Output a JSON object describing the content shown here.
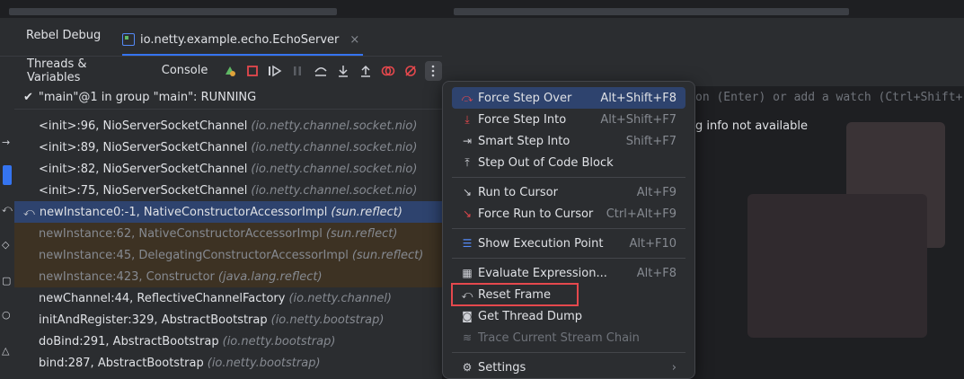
{
  "header": {
    "tool_title": "Rebel Debug",
    "session_tab": "io.netty.example.echo.EchoServer",
    "close_glyph": "×"
  },
  "toolbar": {
    "threads_tab": "Threads & Variables",
    "console_tab": "Console"
  },
  "thread_status": "\"main\"@1 in group \"main\": RUNNING",
  "frames": [
    {
      "method": "<init>:96, NioServerSocketChannel",
      "pkg": "(io.netty.channel.socket.nio)",
      "style": "normal"
    },
    {
      "method": "<init>:89, NioServerSocketChannel",
      "pkg": "(io.netty.channel.socket.nio)",
      "style": "normal"
    },
    {
      "method": "<init>:82, NioServerSocketChannel",
      "pkg": "(io.netty.channel.socket.nio)",
      "style": "normal"
    },
    {
      "method": "<init>:75, NioServerSocketChannel",
      "pkg": "(io.netty.channel.socket.nio)",
      "style": "normal"
    },
    {
      "method": "newInstance0:-1, NativeConstructorAccessorImpl",
      "pkg": "(sun.reflect)",
      "style": "selected"
    },
    {
      "method": "newInstance:62, NativeConstructorAccessorImpl",
      "pkg": "(sun.reflect)",
      "style": "lib"
    },
    {
      "method": "newInstance:45, DelegatingConstructorAccessorImpl",
      "pkg": "(sun.reflect)",
      "style": "lib"
    },
    {
      "method": "newInstance:423, Constructor",
      "pkg": "(java.lang.reflect)",
      "style": "lib"
    },
    {
      "method": "newChannel:44, ReflectiveChannelFactory",
      "pkg": "(io.netty.channel)",
      "style": "normal"
    },
    {
      "method": "initAndRegister:329, AbstractBootstrap",
      "pkg": "(io.netty.bootstrap)",
      "style": "normal"
    },
    {
      "method": "doBind:291, AbstractBootstrap",
      "pkg": "(io.netty.bootstrap)",
      "style": "normal"
    },
    {
      "method": "bind:287, AbstractBootstrap",
      "pkg": "(io.netty.bootstrap)",
      "style": "normal"
    }
  ],
  "watch_hint": "on (Enter) or add a watch (Ctrl+Shift+",
  "info_text": "g info not available",
  "menu": {
    "items": [
      {
        "label": "Force Step Over",
        "shortcut": "Alt+Shift+F8",
        "icon": "force-step-over-icon"
      },
      {
        "label": "Force Step Into",
        "shortcut": "Alt+Shift+F7",
        "icon": "force-step-into-icon"
      },
      {
        "label": "Smart Step Into",
        "shortcut": "Shift+F7",
        "icon": "smart-step-into-icon"
      },
      {
        "label": "Step Out of Code Block",
        "shortcut": "",
        "icon": "step-out-block-icon"
      },
      {
        "label": "Run to Cursor",
        "shortcut": "Alt+F9",
        "icon": "run-to-cursor-icon"
      },
      {
        "label": "Force Run to Cursor",
        "shortcut": "Ctrl+Alt+F9",
        "icon": "force-run-to-cursor-icon"
      },
      {
        "label": "Show Execution Point",
        "shortcut": "Alt+F10",
        "icon": "execution-point-icon"
      },
      {
        "label": "Evaluate Expression...",
        "shortcut": "Alt+F8",
        "icon": "calculator-icon"
      },
      {
        "label": "Reset Frame",
        "shortcut": "",
        "icon": "reset-frame-icon"
      },
      {
        "label": "Get Thread Dump",
        "shortcut": "",
        "icon": "camera-icon"
      },
      {
        "label": "Trace Current Stream Chain",
        "shortcut": "",
        "icon": "stream-trace-icon"
      },
      {
        "label": "Settings",
        "shortcut": "",
        "icon": "gear-icon"
      }
    ]
  },
  "colors": {
    "accent": "#3574f0",
    "selection": "#2e436e",
    "highlight_box": "#e5484d",
    "library_frame_bg": "#3d3223"
  }
}
